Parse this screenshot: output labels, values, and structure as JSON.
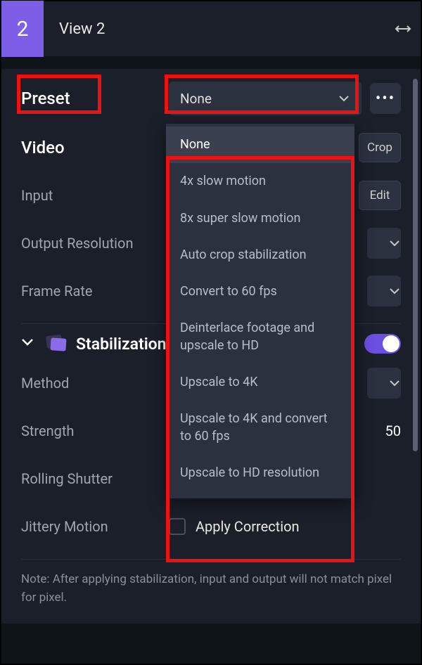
{
  "header": {
    "number": "2",
    "title": "View 2"
  },
  "preset": {
    "label": "Preset",
    "selected": "None",
    "options": [
      "None",
      "4x slow motion",
      "8x super slow motion",
      "Auto crop stabilization",
      "Convert to 60 fps",
      "Deinterlace footage and upscale to HD",
      "Upscale to 4K",
      "Upscale to 4K and convert to 60 fps",
      "Upscale to HD resolution"
    ]
  },
  "video": {
    "heading": "Video",
    "crop_btn": "Crop",
    "input_label": "Input",
    "edit_btn": "Edit",
    "output_res_label": "Output Resolution",
    "frame_rate_label": "Frame Rate"
  },
  "stabilization": {
    "title": "Stabilization",
    "method_label": "Method",
    "strength_label": "Strength",
    "strength_value": "50",
    "rolling_label": "Rolling Shutter",
    "jittery_label": "Jittery Motion",
    "apply_correction": "Apply Correction",
    "note": "Note: After applying stabilization, input and output will not match pixel for pixel."
  }
}
